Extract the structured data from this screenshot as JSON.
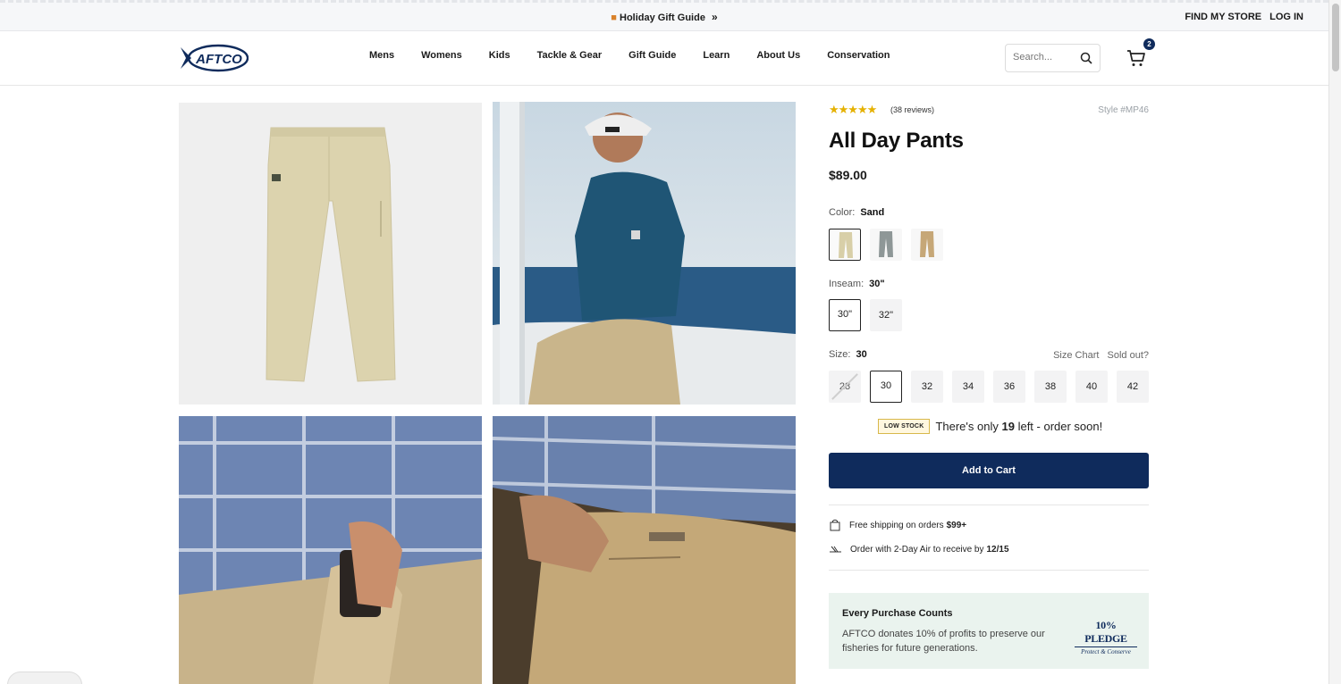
{
  "announcement": {
    "promo_label": "Holiday Gift Guide",
    "find_store": "FIND MY STORE",
    "log_in": "LOG IN"
  },
  "header": {
    "logo_text": "AFTCO",
    "nav": [
      "Mens",
      "Womens",
      "Kids",
      "Tackle & Gear",
      "Gift Guide",
      "Learn",
      "About Us",
      "Conservation"
    ],
    "search_placeholder": "Search...",
    "cart_count": "2"
  },
  "product": {
    "rating_stars": "★★★★★",
    "reviews": "(38 reviews)",
    "style": "Style #MP46",
    "title": "All Day Pants",
    "price": "$89.00",
    "color_label": "Color:",
    "color_value": "Sand",
    "colors": [
      {
        "name": "Sand",
        "hex": "#d8cfa8",
        "selected": true
      },
      {
        "name": "Gray",
        "hex": "#8e9797",
        "selected": false
      },
      {
        "name": "Khaki",
        "hex": "#c6a777",
        "selected": false
      }
    ],
    "inseam_label": "Inseam:",
    "inseam_value": "30\"",
    "inseams": [
      "30\"",
      "32\""
    ],
    "size_label": "Size:",
    "size_value": "30",
    "size_chart": "Size Chart",
    "sold_out": "Sold out?",
    "sizes": [
      "28",
      "30",
      "32",
      "34",
      "36",
      "38",
      "40",
      "42"
    ],
    "low_stock_badge": "LOW STOCK",
    "stock_msg_pre": "There's only",
    "stock_count": "19",
    "stock_msg_post": "left - order soon!",
    "add_to_cart": "Add to Cart",
    "shipping_text": "Free shipping on orders",
    "shipping_threshold": "$99+",
    "air_text": "Order with 2-Day Air to receive by",
    "air_date": "12/15"
  },
  "pledge": {
    "heading": "Every Purchase Counts",
    "text": "AFTCO donates 10% of profits to preserve our fisheries for future generations.",
    "logo_title": "10% PLEDGE",
    "logo_sub": "Protect & Conserve"
  }
}
